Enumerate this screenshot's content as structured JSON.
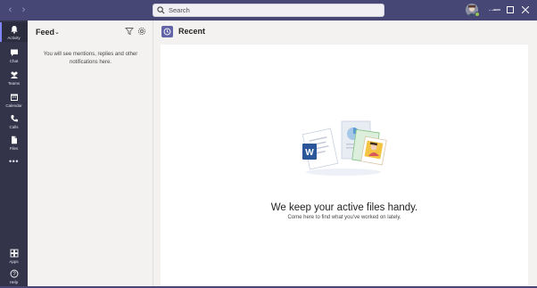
{
  "titlebar": {
    "back_icon": "chevron-left-icon",
    "forward_icon": "chevron-right-icon",
    "search": {
      "placeholder": "Search",
      "icon": "search-icon"
    },
    "window_controls": [
      "more-icon",
      "minimize-icon",
      "maximize-icon",
      "close-icon"
    ]
  },
  "rail": {
    "items": [
      {
        "label": "Activity",
        "icon": "bell-icon",
        "active": true
      },
      {
        "label": "Chat",
        "icon": "chat-icon"
      },
      {
        "label": "Teams",
        "icon": "teams-icon"
      },
      {
        "label": "Calendar",
        "icon": "calendar-icon"
      },
      {
        "label": "Calls",
        "icon": "phone-icon"
      },
      {
        "label": "Files",
        "icon": "file-icon"
      }
    ],
    "more_label": "•••",
    "bottom_items": [
      {
        "label": "Apps",
        "icon": "apps-icon"
      },
      {
        "label": "Help",
        "icon": "help-icon"
      }
    ]
  },
  "feed": {
    "title": "Feed",
    "empty_message": "You will see mentions, replies and other notifications here."
  },
  "main": {
    "title": "Recent",
    "empty_title": "We keep your active files handy.",
    "empty_subtitle": "Come here to find what you've worked on lately."
  },
  "colors": {
    "titlebar": "#464775",
    "rail": "#33344a",
    "accent": "#6264a7",
    "background": "#f3f2f1"
  }
}
